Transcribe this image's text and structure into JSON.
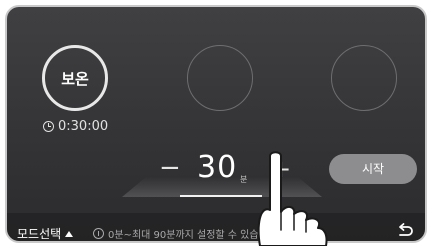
{
  "modes": [
    {
      "label": "보온",
      "active": true
    },
    {
      "label": "",
      "active": false
    },
    {
      "label": "",
      "active": false
    }
  ],
  "timer": {
    "icon": "clock-icon",
    "text": "0:30:00"
  },
  "stepper": {
    "minus": "−",
    "value": "30",
    "unit": "분",
    "plus": "+"
  },
  "start_button": {
    "label": "시작"
  },
  "footer": {
    "mode_select_label": "모드선택",
    "info_text": "0분~최대 90분까지 설정할 수 있습니다.",
    "back_icon": "back-arrow-icon"
  },
  "colors": {
    "background": "#363638",
    "start_button": "#8d8d8f",
    "text": "#ffffff"
  }
}
